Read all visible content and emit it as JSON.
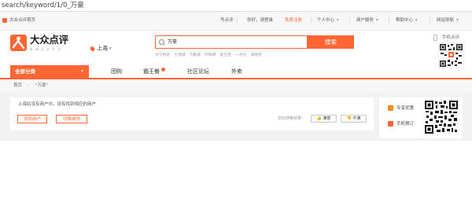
{
  "browser": {
    "url": "search/keyword/1/0_万豪"
  },
  "topbar": {
    "home_link": "大众点评首页",
    "write_review": "写点评",
    "greeting": "你好，请登录",
    "register": "免费注册",
    "personal_center": "个人中心",
    "merchant_center": "商户服务",
    "help_center": "帮助中心",
    "site_nav": "网站导航"
  },
  "logo": {
    "name": "大众点评",
    "slogan": "美 味 品 质 生 活"
  },
  "city": {
    "name": "上海"
  },
  "search": {
    "query": "万豪",
    "button": "搜索",
    "hot_words": [
      "大宁附近",
      "大悦城",
      "万象城",
      "环球港",
      "星巴克",
      "一点点",
      "海底捞"
    ]
  },
  "qr_top": {
    "label": "手机点评"
  },
  "nav": {
    "category": "全部分类",
    "items": [
      "团购",
      "霸王餐",
      "社区论坛",
      "外卖"
    ]
  },
  "breadcrumb": {
    "home": "首页",
    "current": "\"万豪\""
  },
  "result": {
    "message": "上海站没有商户中，没有找到相应的商户",
    "add_merchant": "添加商户",
    "switch_city": "切换城市",
    "feedback_label": "您对搜索结果：",
    "satisfied": "满意",
    "unsatisfied": "不满"
  },
  "sidebar": {
    "deals": "专享优惠",
    "mobile_review": "手机预订"
  },
  "colors": {
    "accent": "#ff6633",
    "brand_orange": "#f08c1e"
  }
}
